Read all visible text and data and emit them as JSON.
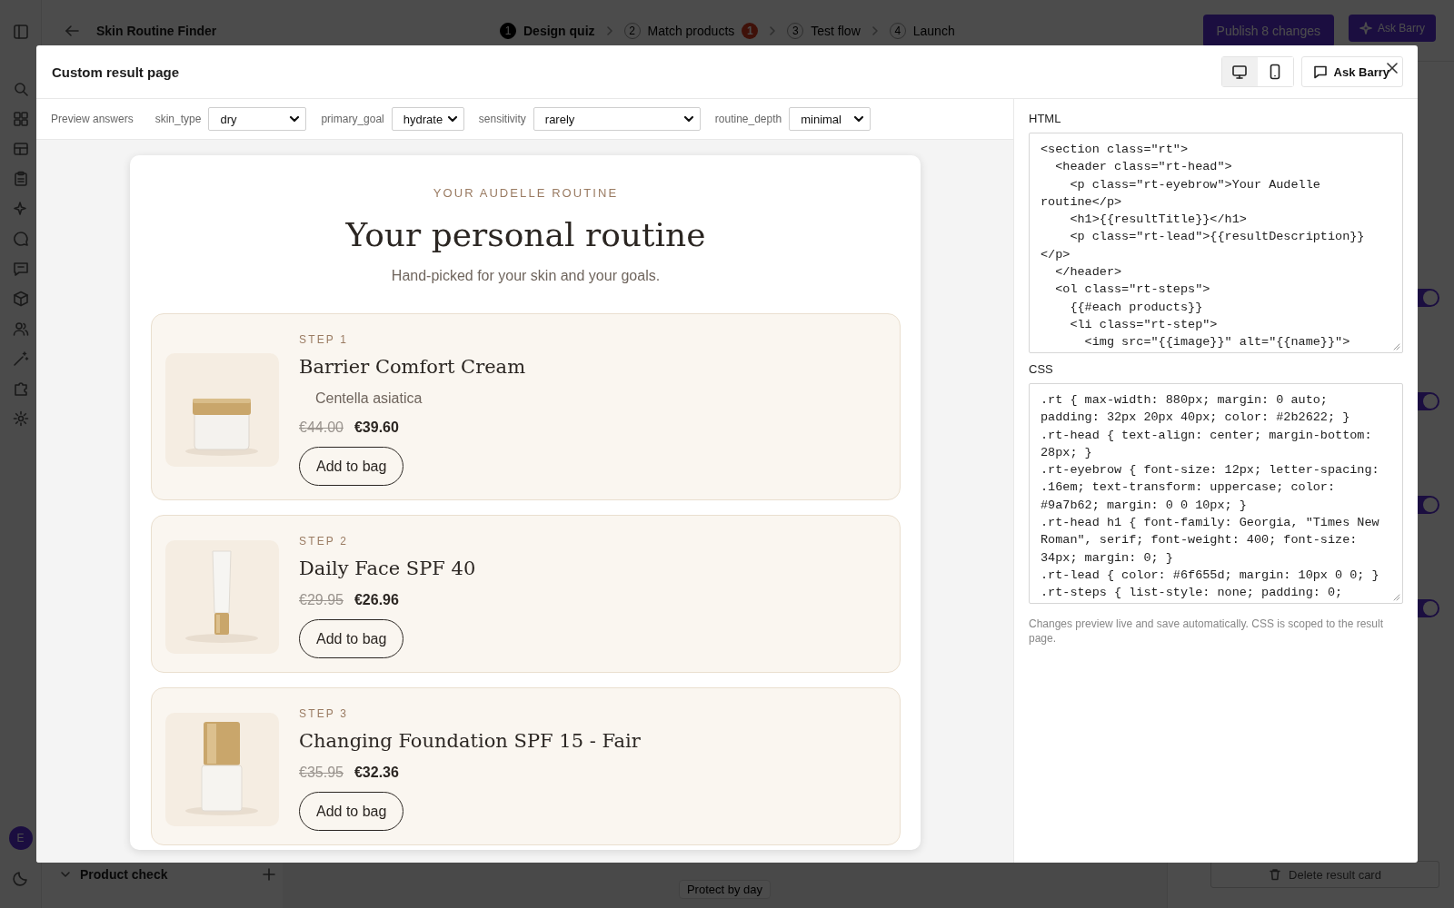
{
  "app": {
    "title": "Skin Routine Finder",
    "steps": [
      {
        "number": "1",
        "label": "Design quiz",
        "selected": true
      },
      {
        "number": "2",
        "label": "Match products",
        "selected": false,
        "badge": "1"
      },
      {
        "number": "3",
        "label": "Test flow",
        "selected": false
      },
      {
        "number": "4",
        "label": "Launch",
        "selected": false
      }
    ],
    "publish_button": "Publish 8 changes",
    "assistant_button": "Ask Barry",
    "avatar": "E",
    "bottom_section": "Product check",
    "bottom_pill": "Protect by day",
    "delete_button": "Delete result card",
    "toggles": [
      {
        "on": true
      },
      {
        "on": true
      },
      {
        "on": true
      },
      {
        "on": true
      }
    ]
  },
  "dialog": {
    "title": "Custom result page",
    "view_modes": [
      {
        "selected": true
      },
      {
        "selected": false
      }
    ],
    "assistant_button": "Ask Barry",
    "preview_label": "Preview answers",
    "answers": [
      {
        "label": "skin_type",
        "value": "dry"
      },
      {
        "label": "primary_goal",
        "value": "hydrate"
      },
      {
        "label": "sensitivity",
        "value": "rarely"
      },
      {
        "label": "routine_depth",
        "value": "minimal"
      }
    ],
    "result": {
      "eyebrow": "YOUR AUDELLE ROUTINE",
      "title": "Your personal routine",
      "lead": "Hand-picked for your skin and your goals.",
      "products": [
        {
          "step": "STEP 1",
          "name": "Barrier Comfort Cream",
          "ingredient": "Centella asiatica",
          "old_price": "€44.00",
          "price": "€39.60",
          "button": "Add to bag"
        },
        {
          "step": "STEP 2",
          "name": "Daily Face SPF 40",
          "old_price": "€29.95",
          "price": "€26.96",
          "button": "Add to bag"
        },
        {
          "step": "STEP 3",
          "name": "Changing Foundation SPF 15 - Fair",
          "old_price": "€35.95",
          "price": "€32.36",
          "button": "Add to bag"
        }
      ]
    },
    "editors": [
      {
        "label": "HTML",
        "lines": [
          "<section class=\"rt\">",
          "  <header class=\"rt-head\">",
          "    <p class=\"rt-eyebrow\">Your Audelle",
          "routine</p>",
          "    <h1>{{resultTitle}}</h1>",
          "    <p class=\"rt-lead\">{{resultDescription}}",
          "</p>",
          "  </header>",
          "  <ol class=\"rt-steps\">",
          "    {{#each products}}",
          "    <li class=\"rt-step\">",
          "      <img src=\"{{image}}\" alt=\"{{name}}\">"
        ]
      },
      {
        "label": "CSS",
        "lines": [
          ".rt { max-width: 880px; margin: 0 auto;",
          "padding: 32px 20px 40px; color: #2b2622; }",
          ".rt-head { text-align: center; margin-bottom:",
          "28px; }",
          ".rt-eyebrow { font-size: 12px; letter-spacing:",
          ".16em; text-transform: uppercase; color:",
          "#9a7b62; margin: 0 0 10px; }",
          ".rt-head h1 { font-family: Georgia, \"Times New",
          "Roman\", serif; font-weight: 400; font-size:",
          "34px; margin: 0; }",
          ".rt-lead { color: #6f655d; margin: 10px 0 0; }",
          ".rt-steps { list-style: none; padding: 0;"
        ]
      }
    ],
    "note": "Changes preview live and save automatically. CSS is scoped to the result page."
  }
}
